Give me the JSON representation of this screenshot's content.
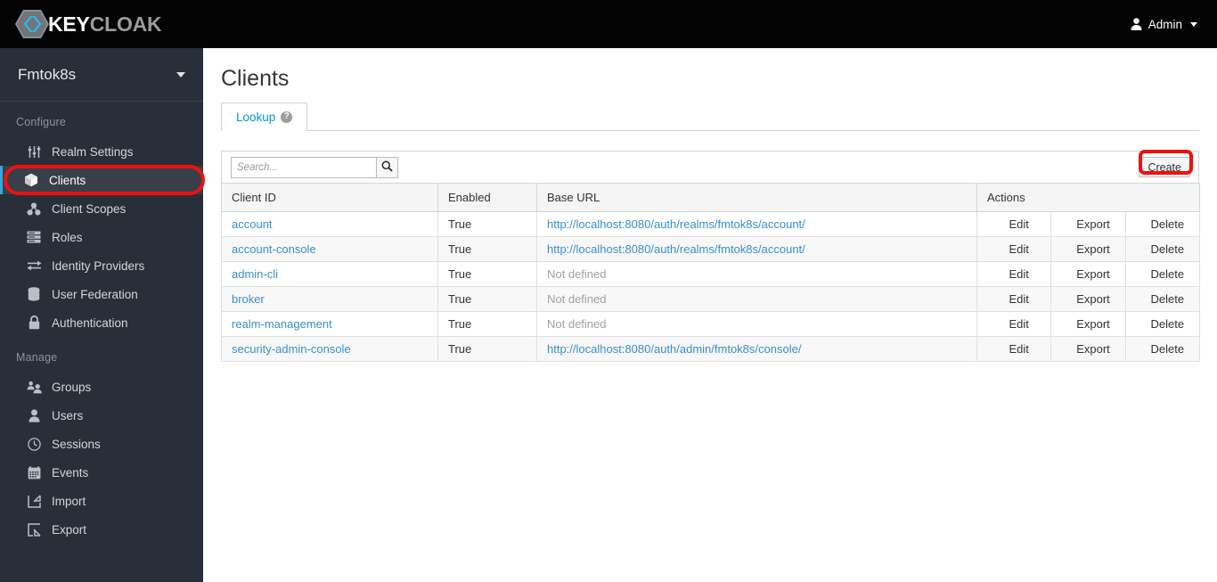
{
  "header": {
    "brand_primary": "KEY",
    "brand_secondary": "CLOAK",
    "logo_icon": "keycloak-hexagon-logo",
    "user_label": "Admin",
    "user_icon": "user-icon",
    "caret_icon": "chevron-down-icon"
  },
  "sidebar": {
    "realm_name": "Fmtok8s",
    "realm_caret_icon": "chevron-down-icon",
    "sections": [
      {
        "label": "Configure",
        "items": [
          {
            "label": "Realm Settings",
            "icon": "sliders-icon",
            "active": false
          },
          {
            "label": "Clients",
            "icon": "cube-icon",
            "active": true
          },
          {
            "label": "Client Scopes",
            "icon": "molecule-icon",
            "active": false
          },
          {
            "label": "Roles",
            "icon": "stacked-list-icon",
            "active": false
          },
          {
            "label": "Identity Providers",
            "icon": "exchange-arrows-icon",
            "active": false
          },
          {
            "label": "User Federation",
            "icon": "database-icon",
            "active": false
          },
          {
            "label": "Authentication",
            "icon": "lock-icon",
            "active": false
          }
        ]
      },
      {
        "label": "Manage",
        "items": [
          {
            "label": "Groups",
            "icon": "groups-icon",
            "active": false
          },
          {
            "label": "Users",
            "icon": "user-icon",
            "active": false
          },
          {
            "label": "Sessions",
            "icon": "clock-icon",
            "active": false
          },
          {
            "label": "Events",
            "icon": "calendar-icon",
            "active": false
          },
          {
            "label": "Import",
            "icon": "import-arrow-icon",
            "active": false
          },
          {
            "label": "Export",
            "icon": "export-arrow-icon",
            "active": false
          }
        ]
      }
    ]
  },
  "main": {
    "page_title": "Clients",
    "tabs": [
      {
        "label": "Lookup",
        "help_icon": "question-mark-icon",
        "active": true
      }
    ],
    "toolbar": {
      "search_placeholder": "Search...",
      "search_value": "",
      "search_icon": "search-icon",
      "create_label": "Create"
    },
    "table": {
      "columns": [
        "Client ID",
        "Enabled",
        "Base URL",
        "Actions"
      ],
      "action_labels": [
        "Edit",
        "Export",
        "Delete"
      ],
      "not_defined_text": "Not defined",
      "rows": [
        {
          "client_id": "account",
          "enabled": "True",
          "base_url": "http://localhost:8080/auth/realms/fmtok8s/account/",
          "base_url_defined": true
        },
        {
          "client_id": "account-console",
          "enabled": "True",
          "base_url": "http://localhost:8080/auth/realms/fmtok8s/account/",
          "base_url_defined": true
        },
        {
          "client_id": "admin-cli",
          "enabled": "True",
          "base_url": "Not defined",
          "base_url_defined": false
        },
        {
          "client_id": "broker",
          "enabled": "True",
          "base_url": "Not defined",
          "base_url_defined": false
        },
        {
          "client_id": "realm-management",
          "enabled": "True",
          "base_url": "Not defined",
          "base_url_defined": false
        },
        {
          "client_id": "security-admin-console",
          "enabled": "True",
          "base_url": "http://localhost:8080/auth/admin/fmtok8s/console/",
          "base_url_defined": true
        }
      ]
    }
  },
  "annotations": {
    "color": "#ee1111",
    "highlights": [
      "sidebar-item-clients",
      "create-button"
    ]
  }
}
